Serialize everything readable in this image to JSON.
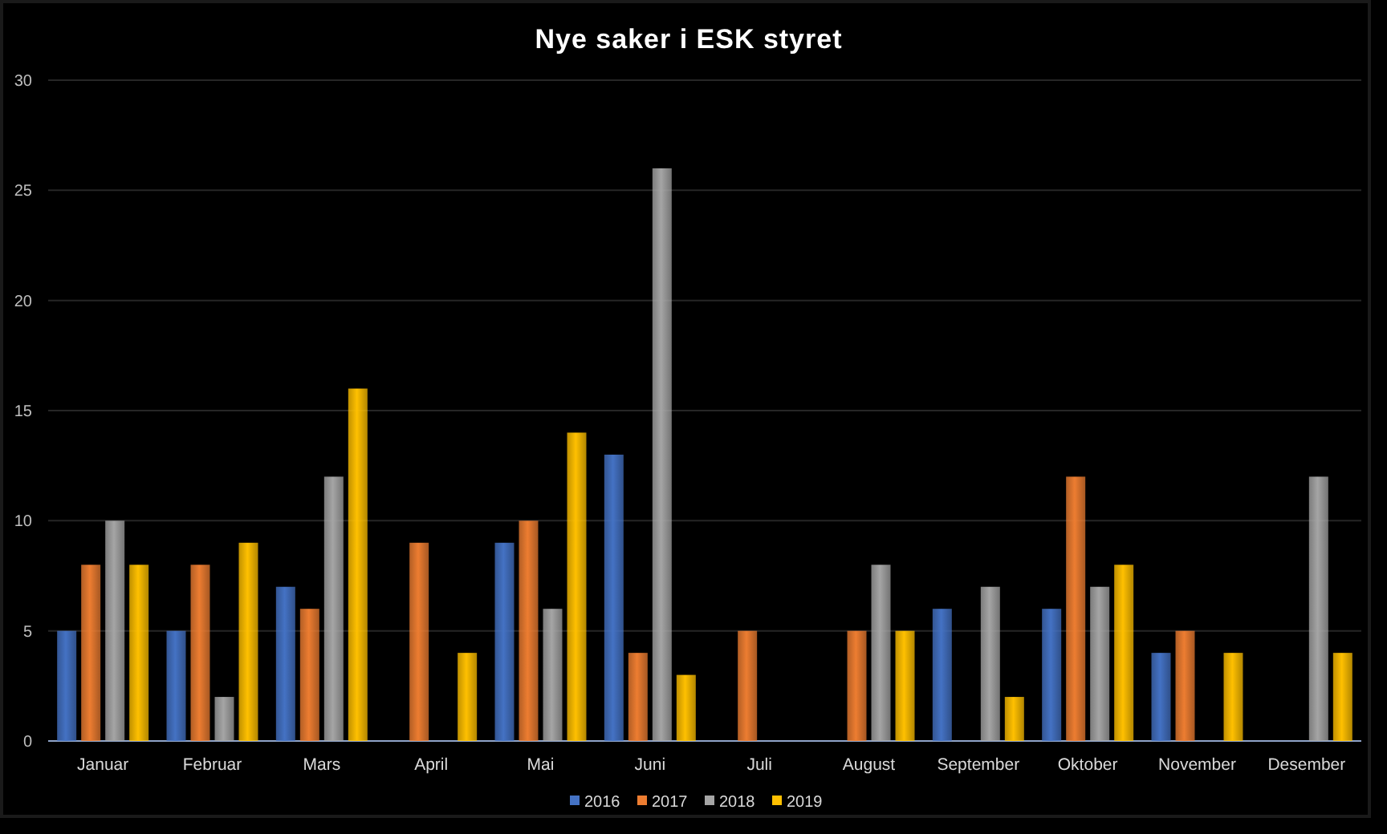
{
  "chart_data": {
    "type": "bar",
    "title": "Nye saker i ESK styret",
    "categories": [
      "Januar",
      "Februar",
      "Mars",
      "April",
      "Mai",
      "Juni",
      "Juli",
      "August",
      "September",
      "Oktober",
      "November",
      "Desember"
    ],
    "series": [
      {
        "name": "2016",
        "color": "#4472c4",
        "values": [
          5,
          5,
          7,
          null,
          9,
          13,
          null,
          null,
          6,
          6,
          4,
          null
        ]
      },
      {
        "name": "2017",
        "color": "#ed7d31",
        "values": [
          8,
          8,
          6,
          9,
          10,
          4,
          5,
          5,
          null,
          12,
          5,
          null
        ]
      },
      {
        "name": "2018",
        "color": "#a5a5a5",
        "values": [
          10,
          2,
          12,
          null,
          6,
          26,
          null,
          8,
          7,
          7,
          null,
          12
        ]
      },
      {
        "name": "2019",
        "color": "#ffc000",
        "values": [
          8,
          9,
          16,
          4,
          14,
          3,
          null,
          5,
          2,
          8,
          4,
          4
        ]
      }
    ],
    "ylim": [
      0,
      30
    ],
    "yticks": [
      0,
      5,
      10,
      15,
      20,
      25,
      30
    ],
    "grid": true,
    "legend": true
  }
}
